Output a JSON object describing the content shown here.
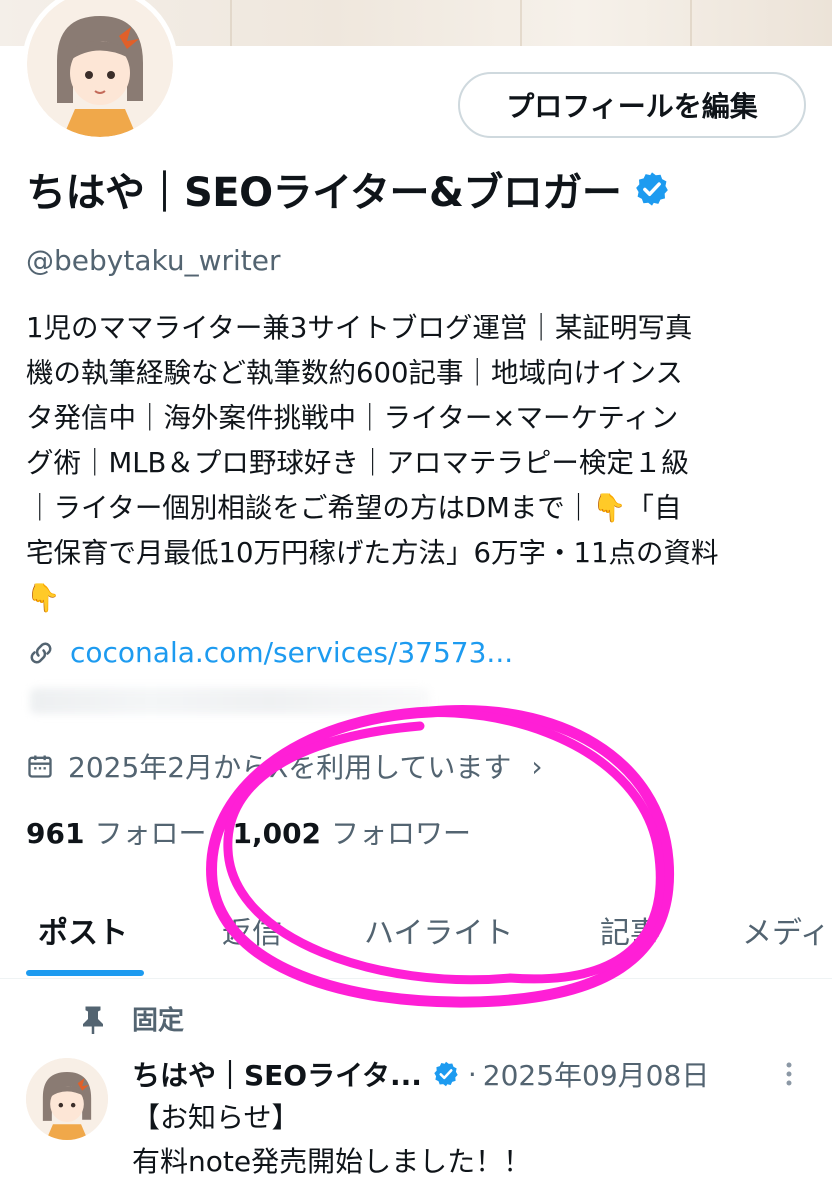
{
  "profile": {
    "edit_button_label": "プロフィールを編集",
    "display_name": "ちはや｜SEOライター&ブロガー",
    "handle": "@bebytaku_writer",
    "bio_lines": [
      "1児のママライター兼3サイトブログ運営｜某証明写真",
      "機の執筆経験など執筆数約600記事｜地域向けインス",
      "タ発信中｜海外案件挑戦中｜ライター×マーケティン",
      "グ術｜MLB＆プロ野球好き｜アロマテラピー検定１級",
      "｜ライター個別相談をご希望の方はDMまで｜👇「自",
      "宅保育で月最低10万円稼げた方法」6万字・11点の資料",
      "👇"
    ],
    "link_text": "coconala.com/services/37573...",
    "joined_text": "2025年2月からXを利用しています",
    "joined_chevron": "›",
    "following_count": "961",
    "following_label": "フォロー",
    "followers_count": "1,002",
    "followers_label": "フォロワー"
  },
  "tabs": [
    {
      "label": "ポスト",
      "active": true
    },
    {
      "label": "返信",
      "active": false
    },
    {
      "label": "ハイライト",
      "active": false
    },
    {
      "label": "記事",
      "active": false
    },
    {
      "label": "メディア",
      "active": false
    }
  ],
  "pinned_post": {
    "pinned_label": "固定",
    "author_name": "ちはや｜SEOライタ...",
    "dot": "·",
    "date": "2025年09月08日",
    "body_lines": [
      "【お知らせ】",
      "有料note発売開始しました！！"
    ]
  },
  "colors": {
    "accent": "#1d9bf0",
    "annotation_marker": "#ff1fd6",
    "secondary_text": "#536471"
  },
  "icons": {
    "verified": "verified-badge-icon",
    "link": "link-icon",
    "calendar": "calendar-icon",
    "pin": "pin-icon",
    "more": "more-icon"
  }
}
